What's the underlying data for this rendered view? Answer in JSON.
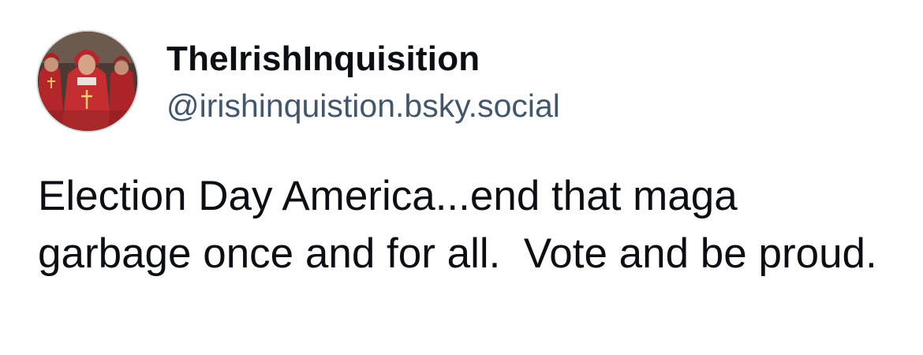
{
  "post": {
    "author": {
      "display_name": "TheIrishInquisition",
      "handle": "@irishinquistion.bsky.social",
      "avatar_icon": "profile-photo-red-robed-cardinals"
    },
    "text": "Election Day America...end that maga garbage once and for all.  Vote and be proud."
  },
  "colors": {
    "text_primary": "#0b0f14",
    "handle_text": "#42576c",
    "background": "#ffffff"
  }
}
